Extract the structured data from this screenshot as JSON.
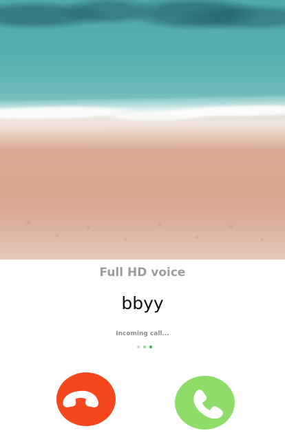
{
  "wallpaper": {
    "name": "beach-aerial-wallpaper"
  },
  "call": {
    "audio_label": "Full HD voice",
    "caller_name": "bbyy",
    "status": "Incoming call..."
  },
  "actions": {
    "decline_icon": "hangup-phone-icon",
    "accept_icon": "phone-icon"
  },
  "colors": {
    "decline": "#f4471e",
    "accept": "#8fdc68",
    "audio_label": "#9d9d9d",
    "caller_name": "#111111",
    "status": "#8d8d8d",
    "dot_active": "#37b63c"
  }
}
